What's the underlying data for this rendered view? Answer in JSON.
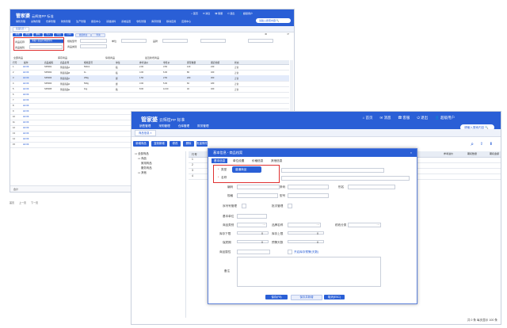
{
  "app": {
    "logo": "管家婆",
    "logo_sub": "云辉煌PP 标准",
    "menu": [
      "销售管理",
      "采购管理",
      "仓库管理",
      "财务管理",
      "生产管理",
      "报表中心",
      "基础资料",
      "系统设置",
      "零售管理",
      "库存管理",
      "移动应用",
      "应用中心"
    ],
    "top_links": [
      "首页",
      "消息",
      "客服",
      "退出"
    ],
    "user": "超级用户",
    "search_placeholder": "请输入搜索内容"
  },
  "small_window": {
    "tab": "商品信息",
    "toolbar": [
      "新增",
      "修改",
      "删除",
      "导入",
      "导出",
      "打印",
      "批量修改",
      "查询"
    ],
    "search_fields": [
      {
        "label": "商品名称",
        "value": "请输入商品名称或条码"
      },
      {
        "label": "商品编码",
        "value": ""
      },
      {
        "label": "规格型号",
        "value": ""
      },
      {
        "label": "商品类别",
        "value": ""
      },
      {
        "label": "单位",
        "value": ""
      },
      {
        "label": "品牌",
        "value": ""
      }
    ],
    "filters": [
      "全部商品",
      "库存商品",
      "停用商品",
      "最近新增商品"
    ],
    "headers": [
      "行号",
      "操作",
      "商品编码",
      "商品名称",
      "规格型号",
      "单位",
      "参考进价",
      "零售价",
      "库存数量",
      "期初金额",
      "状态"
    ],
    "rows": [
      [
        "1",
        "",
        "SP0001",
        "测试商品A",
        "500ml",
        "瓶",
        "2.00",
        "3.50",
        "120",
        "240",
        "正常"
      ],
      [
        "2",
        "",
        "SP0002",
        "测试商品B",
        "1L",
        "瓶",
        "4.00",
        "6.00",
        "80",
        "320",
        "正常"
      ],
      [
        "3",
        "",
        "SP0003",
        "测试商品C",
        "250g",
        "袋",
        "1.50",
        "2.50",
        "200",
        "300",
        "正常"
      ],
      [
        "4",
        "",
        "SP0004",
        "测试商品D",
        "500g",
        "袋",
        "3.00",
        "5.00",
        "60",
        "180",
        "正常"
      ],
      [
        "5",
        "",
        "SP0005",
        "测试商品E",
        "1kg",
        "箱",
        "8.00",
        "12.00",
        "40",
        "320",
        "正常"
      ],
      [
        "6",
        "",
        "",
        "",
        "",
        "",
        "",
        "",
        "",
        "",
        ""
      ],
      [
        "7",
        "",
        "",
        "",
        "",
        "",
        "",
        "",
        "",
        "",
        ""
      ],
      [
        "8",
        "",
        "",
        "",
        "",
        "",
        "",
        "",
        "",
        "",
        ""
      ],
      [
        "9",
        "",
        "",
        "",
        "",
        "",
        "",
        "",
        "",
        "",
        ""
      ],
      [
        "10",
        "",
        "",
        "",
        "",
        "",
        "",
        "",
        "",
        "",
        ""
      ],
      [
        "11",
        "",
        "",
        "",
        "",
        "",
        "",
        "",
        "",
        "",
        ""
      ],
      [
        "12",
        "",
        "",
        "",
        "",
        "",
        "",
        "",
        "",
        "",
        ""
      ],
      [
        "13",
        "",
        "",
        "",
        "",
        "",
        "",
        "",
        "",
        "",
        ""
      ],
      [
        "14",
        "",
        "",
        "",
        "",
        "",
        "",
        "",
        "",
        "",
        ""
      ],
      [
        "15",
        "",
        "",
        "",
        "",
        "",
        "",
        "",
        "",
        "",
        ""
      ]
    ],
    "footer_left": "合计",
    "footer_links": [
      "首页",
      "上一页",
      "下一页"
    ]
  },
  "big_window": {
    "tab": "商品信息",
    "toolbar": [
      "新增商品",
      "复制新增",
      "修改",
      "删除",
      "批量修改"
    ],
    "tree": [
      "全部商品",
      "商品",
      "家用商品",
      "服务商品",
      "其他"
    ],
    "grid_cols": [
      "行号",
      "商品编码",
      "商品名称"
    ],
    "right_cols": [
      "参考进价",
      "期初数量",
      "期初金额"
    ],
    "row_nums": [
      "1",
      "2",
      "3",
      "4"
    ],
    "pager": "共 0 条 每页显示 100 条"
  },
  "dialog": {
    "title": "基本信息 - 商品档案",
    "tabs": [
      "基本信息",
      "单位设置",
      "价格信息",
      "其他信息"
    ],
    "fields": {
      "type_label": "类型",
      "type_value": "普通商品",
      "name_label": "名称",
      "code_label": "编码",
      "barcode_label": "条码",
      "alias_label": "别名",
      "spec_label": "规格",
      "model_label": "型号",
      "origin_label": "产地",
      "serial_label": "序列号管理",
      "batch_label": "批次管理",
      "unit_label": "基本单位",
      "category_label": "商品类别",
      "brand_label": "品牌名称",
      "tax_label": "税收分类",
      "min_label": "库存下限",
      "min_value": "0",
      "max_label": "库存上限",
      "max_value": "0",
      "shelf_label": "保质期",
      "shelf_value": "0",
      "warn_label": "预警天数",
      "warn_value": "0",
      "attr_label": "商品属性",
      "note_label": "备注",
      "checkbox_text": "开启库存预警(天数)"
    },
    "buttons": [
      "保存(F8)",
      "保存并新增",
      "取消(ESC)"
    ]
  },
  "colors": {
    "primary": "#2a5fd6",
    "highlight": "#e03131"
  }
}
